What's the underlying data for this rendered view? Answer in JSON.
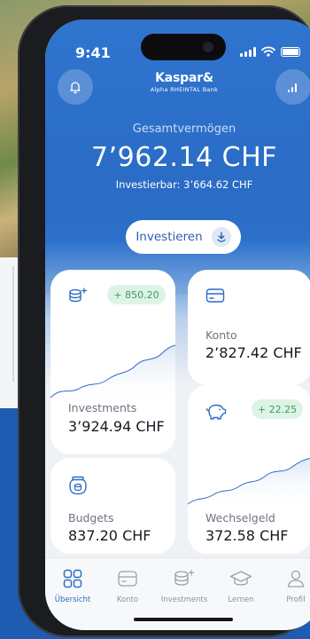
{
  "status_bar": {
    "time": "9:41"
  },
  "header": {
    "logo_main": "Kaspar&",
    "logo_sub": "Alpha RHEINTAL Bank",
    "notification_icon": "bell-icon",
    "stats_icon": "signal-bars-icon"
  },
  "summary": {
    "label": "Gesamtvermögen",
    "amount": "7’962.14 CHF",
    "investable": "Investierbar: 3’664.62 CHF"
  },
  "invest_button": {
    "label": "Investieren",
    "icon": "download-circle-icon"
  },
  "cards": {
    "investments": {
      "title": "Investments",
      "value": "3’924.94 CHF",
      "badge": "+ 850.20",
      "icon": "coins-sparkle-icon"
    },
    "konto": {
      "title": "Konto",
      "value": "2’827.42 CHF",
      "icon": "card-icon"
    },
    "budgets": {
      "title": "Budgets",
      "value": "837.20 CHF",
      "icon": "jar-icon"
    },
    "wechselgeld": {
      "title": "Wechselgeld",
      "value": "372.58 CHF",
      "badge": "+ 22.25",
      "icon": "piggy-bank-icon"
    }
  },
  "tabbar": {
    "items": [
      {
        "label": "Übersicht",
        "icon": "grid-icon",
        "active": true
      },
      {
        "label": "Konto",
        "icon": "card-icon",
        "active": false
      },
      {
        "label": "Investments",
        "icon": "coins-sparkle-icon",
        "active": false
      },
      {
        "label": "Lernen",
        "icon": "graduation-cap-icon",
        "active": false
      },
      {
        "label": "Profil",
        "icon": "user-icon",
        "active": false
      }
    ]
  },
  "colors": {
    "primary": "#2a6cc6",
    "positive": "#3d9a63",
    "positive_bg": "#ddf3e6"
  }
}
